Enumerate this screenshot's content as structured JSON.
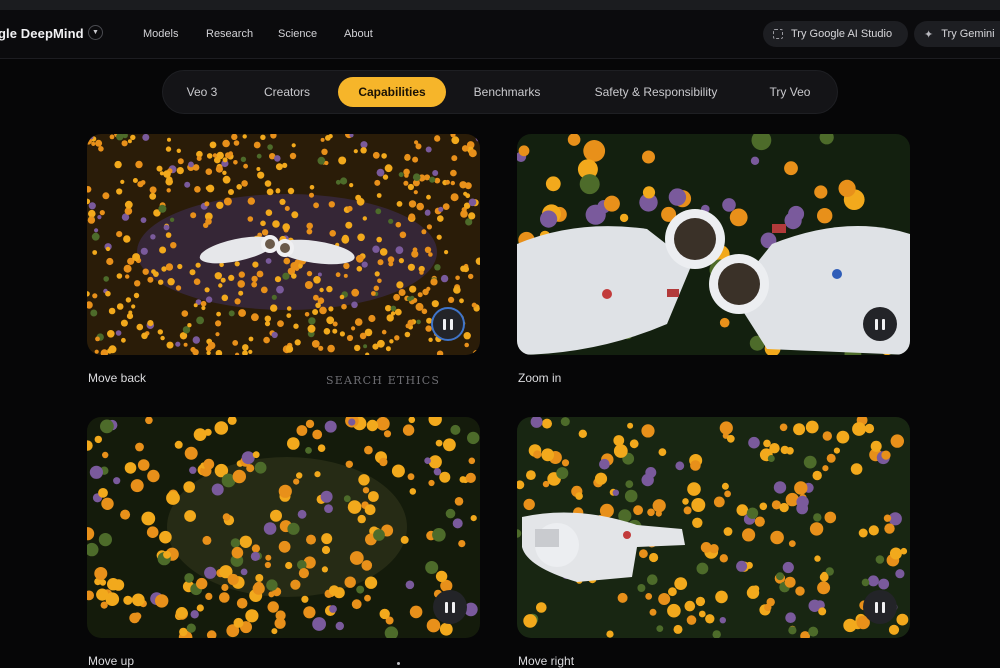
{
  "header": {
    "brand": "gle DeepMind",
    "nav": [
      "Models",
      "Research",
      "Science",
      "About"
    ],
    "cta_studio": "Try Google AI Studio",
    "cta_gemini": "Try Gemini"
  },
  "tabs": [
    {
      "label": "Veo 3",
      "active": false
    },
    {
      "label": "Creators",
      "active": false
    },
    {
      "label": "Capabilities",
      "active": true
    },
    {
      "label": "Benchmarks",
      "active": false
    },
    {
      "label": "Safety & Responsibility",
      "active": false
    },
    {
      "label": "Try Veo",
      "active": false
    }
  ],
  "cards": [
    {
      "caption": "Move back"
    },
    {
      "caption": "Zoom in"
    },
    {
      "caption": "Move up"
    },
    {
      "caption": "Move right"
    }
  ],
  "watermark": "SEARCH ETHICS",
  "colors": {
    "accent": "#f6b52a",
    "background": "#060607",
    "focus_ring": "#3f74c9"
  }
}
